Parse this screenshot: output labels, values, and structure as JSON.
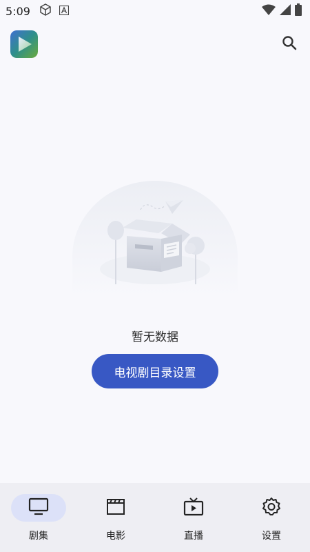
{
  "status_bar": {
    "time": "5:09",
    "icons_left": [
      "cube-icon",
      "a-badge-icon"
    ],
    "icons_right": [
      "wifi-icon",
      "signal-icon",
      "battery-icon"
    ]
  },
  "app_bar": {
    "logo_icon": "play-logo-icon",
    "search_icon": "search-icon"
  },
  "empty_state": {
    "illustration": "empty-box-icon",
    "message": "暂无数据",
    "button_label": "电视剧目录设置"
  },
  "bottom_nav": {
    "items": [
      {
        "label": "剧集",
        "icon": "tv-icon",
        "active": true
      },
      {
        "label": "电影",
        "icon": "clapperboard-icon",
        "active": false
      },
      {
        "label": "直播",
        "icon": "live-tv-icon",
        "active": false
      },
      {
        "label": "设置",
        "icon": "gear-icon",
        "active": false
      }
    ]
  },
  "colors": {
    "accent": "#3858c4",
    "nav_active_bg": "#dce1f8",
    "background": "#f8f8fc",
    "nav_bg": "#eeeef3"
  }
}
